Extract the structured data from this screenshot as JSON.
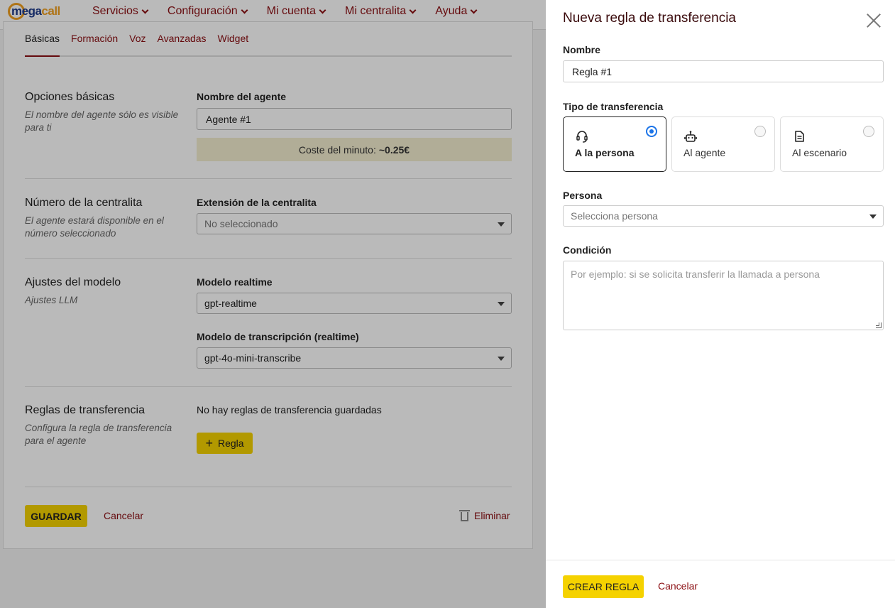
{
  "brand": {
    "name_part1": "mega",
    "name_part2": "call"
  },
  "nav": {
    "items": [
      "Servicios",
      "Configuración",
      "Mi cuenta",
      "Mi centralita",
      "Ayuda"
    ]
  },
  "tabs": [
    "Básicas",
    "Formación",
    "Voz",
    "Avanzadas",
    "Widget"
  ],
  "sections": {
    "basic": {
      "title": "Opciones básicas",
      "desc": "El nombre del agente sólo es visible para ti",
      "agent_name_label": "Nombre del agente",
      "agent_name_value": "Agente #1",
      "cost_label": "Coste del minuto:",
      "cost_value": "~0.25€"
    },
    "number": {
      "title": "Número de la centralita",
      "desc": "El agente estará disponible en el número seleccionado",
      "ext_label": "Extensión de la centralita",
      "ext_value": "No seleccionado"
    },
    "model": {
      "title": "Ajustes del modelo",
      "desc": "Ajustes LLM",
      "realtime_label": "Modelo realtime",
      "realtime_value": "gpt-realtime",
      "transcription_label": "Modelo de transcripción (realtime)",
      "transcription_value": "gpt-4o-mini-transcribe"
    },
    "rules": {
      "title": "Reglas de transferencia",
      "desc": "Configura la regla de transferencia para el agente",
      "empty_text": "No hay reglas de transferencia guardadas",
      "add_button": "Regla"
    }
  },
  "actions": {
    "save": "GUARDAR",
    "cancel": "Cancelar",
    "delete": "Eliminar"
  },
  "drawer": {
    "title": "Nueva regla de transferencia",
    "name_label": "Nombre",
    "name_value": "Regla #1",
    "type_label": "Tipo de transferencia",
    "types": [
      {
        "label": "A la persona",
        "icon": "headset-icon",
        "selected": true
      },
      {
        "label": "Al agente",
        "icon": "robot-icon",
        "selected": false
      },
      {
        "label": "Al escenario",
        "icon": "document-icon",
        "selected": false
      }
    ],
    "person_label": "Persona",
    "person_placeholder": "Selecciona persona",
    "condition_label": "Condición",
    "condition_placeholder": "Por ejemplo: si se solicita transferir la llamada a persona",
    "create_button": "CREAR REGLA",
    "cancel_button": "Cancelar"
  },
  "colors": {
    "accent_yellow": "#f5d200",
    "link_red": "#8b0e12",
    "radio_blue": "#1a73e8"
  }
}
